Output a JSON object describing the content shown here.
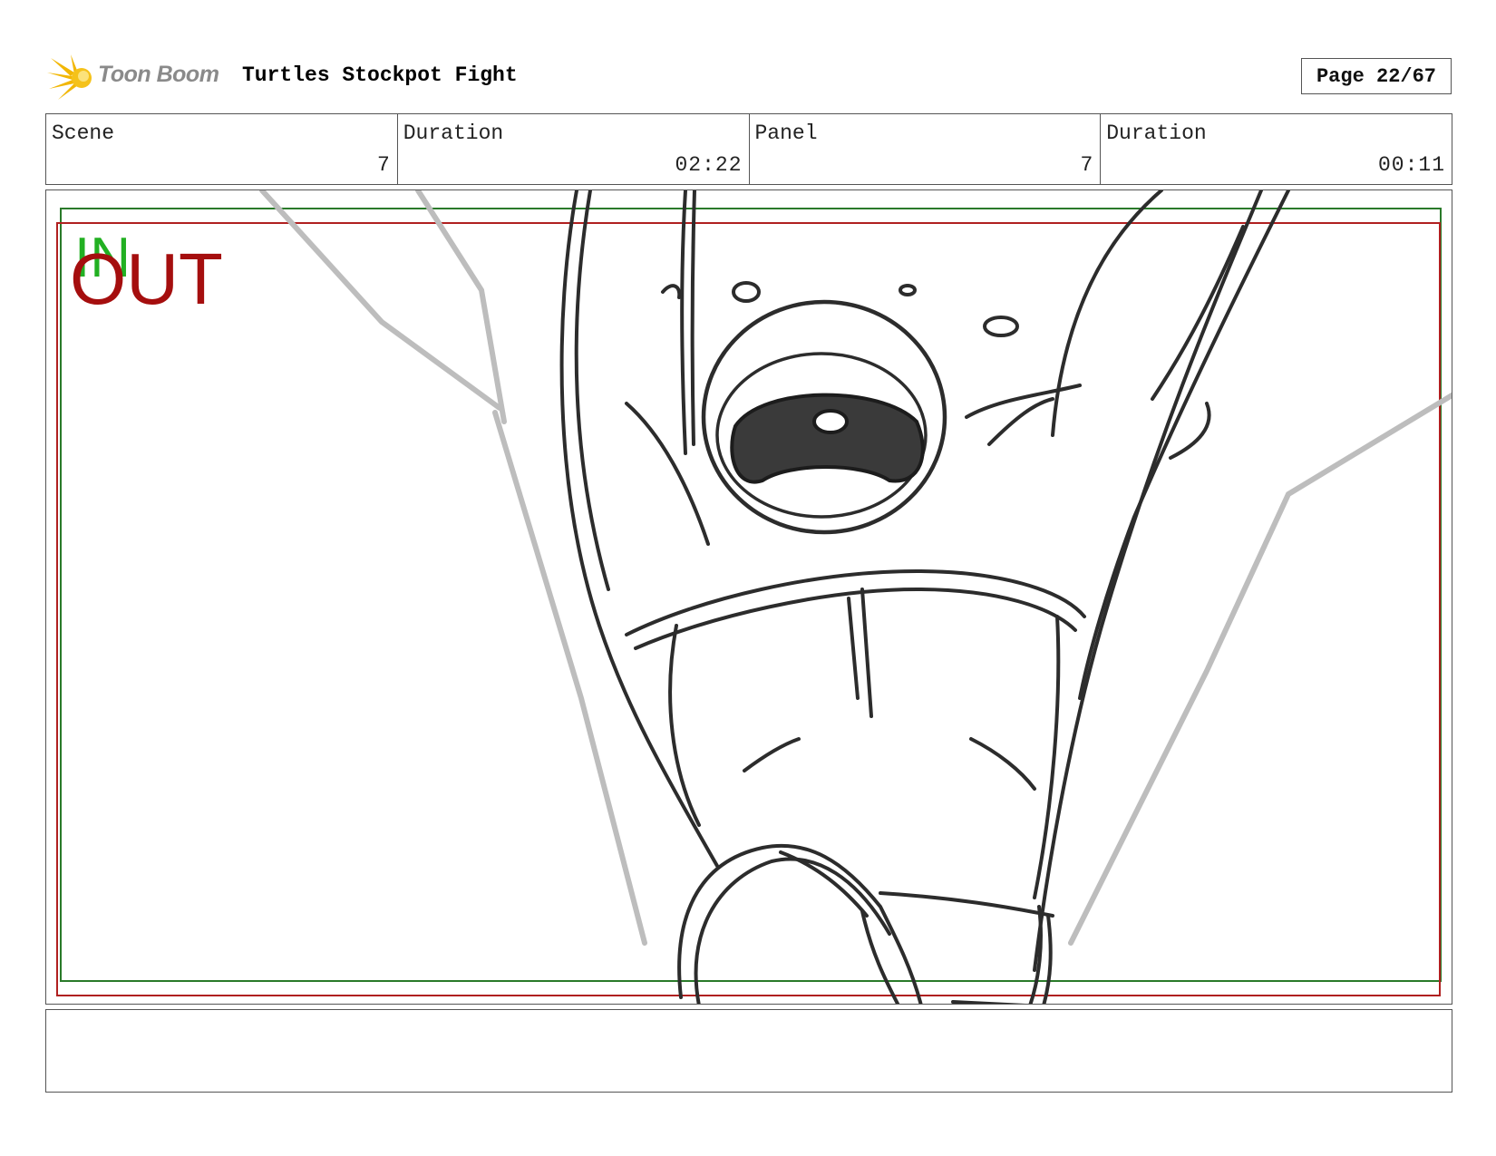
{
  "header": {
    "logo_text": "Toon Boom",
    "title": "Turtles Stockpot Fight",
    "page": "Page 22/67"
  },
  "info": [
    {
      "label": "Scene",
      "value": "7"
    },
    {
      "label": "Duration",
      "value": "02:22"
    },
    {
      "label": "Panel",
      "value": "7"
    },
    {
      "label": "Duration",
      "value": "00:11"
    }
  ],
  "panel": {
    "in_marker": "IN",
    "out_marker": "OUT",
    "in_color": "#22b022",
    "out_color": "#a50e0e"
  },
  "notes": {
    "text": ""
  }
}
